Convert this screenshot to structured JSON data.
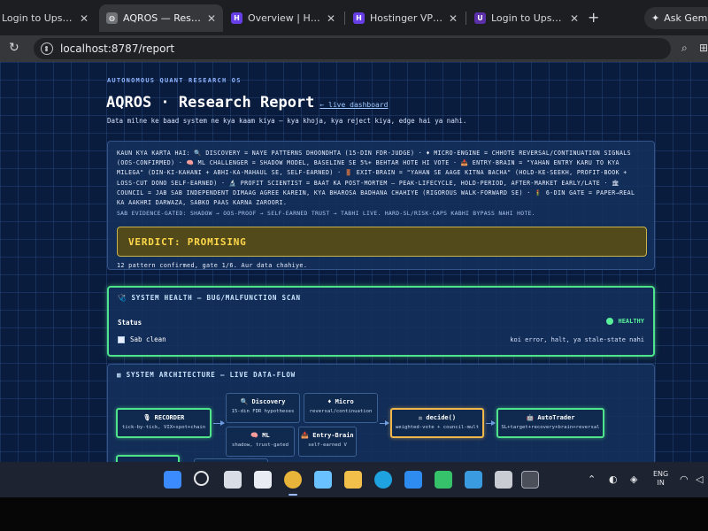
{
  "browser": {
    "tabs": [
      {
        "title": "Login to Upstox",
        "favicon": "upstox-icon",
        "color": "#5b2fa8",
        "active": false
      },
      {
        "title": "AQROS — Research",
        "favicon": "globe-icon",
        "color": "#6f7378",
        "active": true
      },
      {
        "title": "Overview | Hostinger",
        "favicon": "hostinger-icon",
        "color": "#673de6",
        "active": false
      },
      {
        "title": "Hostinger VPS Web",
        "favicon": "hostinger-icon",
        "color": "#673de6",
        "active": false
      },
      {
        "title": "Login to Upstox",
        "favicon": "upstox-icon",
        "color": "#5b2fa8",
        "active": false
      }
    ],
    "new_tab_symbol": "+",
    "gemini_label": "Ask Gemini",
    "url": "localhost:8787/report"
  },
  "report": {
    "kicker": "AUTONOMOUS QUANT RESEARCH OS",
    "title": "AQROS · Research Report",
    "title_tag": "← live dashboard",
    "subtitle": "Data milne ke baad system ne kya kaam kiya — kya khoja, kya reject kiya, edge hai ya nahi.",
    "intro": {
      "text": "Kaun kya karta hai: 🔍 Discovery = naye patterns dhoondhta (15-din FDR-judge) · ♦ Micro-Engine = chhote reversal/continuation signals (OOS-confirmed) · 🧠 ML Challenger = shadow model, baseline se 5%+ behtar hote hi vote · 📥 Entry-Brain = \"yahan entry karu to kya milega\" (din-ki-kahani + abhi-ka-mahaul se, self-earned) · 🚪 Exit-Brain = \"yahan se aage kitna bacha\" (hold-ke-seekh, profit-book + loss-cut dono self-earned) · 🔬 Profit Scientist = baat ka post-mortem — peak-lifecycle, hold-period, after-market early/late · 🏛 Council = jab sab independent dimaag agree karein, kya bharosa badhana chahiye (rigorous walk-forward se) · 🚦 6-din gate = paper→real ka aakhri darwaza, sabko paas karna zaroori.",
      "note": "Sab evidence-gated: shadow → OOS-proof → self-earned trust → tabhi live. Hard-SL/risk-caps kabhi bypass nahi hote."
    },
    "verdict": {
      "label": "VERDICT: PROMISING",
      "note": "12 pattern confirmed, gate 1/6. Aur data chahiye.",
      "color": "#ffd84a"
    },
    "health": {
      "heading": "🩺 SYSTEM HEALTH — BUG/MALFUNCTION SCAN",
      "status_label": "Status",
      "status_value": "HEALTHY",
      "status_color": "#59f09a",
      "check_label": "Sab clean",
      "check_detail": "koi error, halt, ya stale-state nahi"
    },
    "architecture": {
      "heading": "▦ SYSTEM ARCHITECTURE — LIVE DATA-FLOW",
      "nodes": {
        "recorder": {
          "title": "🎙 RECORDER",
          "sub": "tick-by-tick, VIX+spot+chain"
        },
        "discovery": {
          "title": "🔍 Discovery",
          "sub": "15-din FDR hypotheses"
        },
        "micro": {
          "title": "♦ Micro",
          "sub": "reversal/continuation"
        },
        "ml": {
          "title": "🧠 ML",
          "sub": "shadow, trust-gated"
        },
        "entry": {
          "title": "📥 Entry-Brain",
          "sub": "self-earned V"
        },
        "decide": {
          "title": "⚖ decide()",
          "sub": "weighted-vote + council-mult"
        },
        "autotrader": {
          "title": "🤖 AutoTrader",
          "sub": "SL+target+recovery+brain+reversal"
        }
      }
    }
  },
  "taskbar": {
    "language": "ENG",
    "region": "IN"
  }
}
